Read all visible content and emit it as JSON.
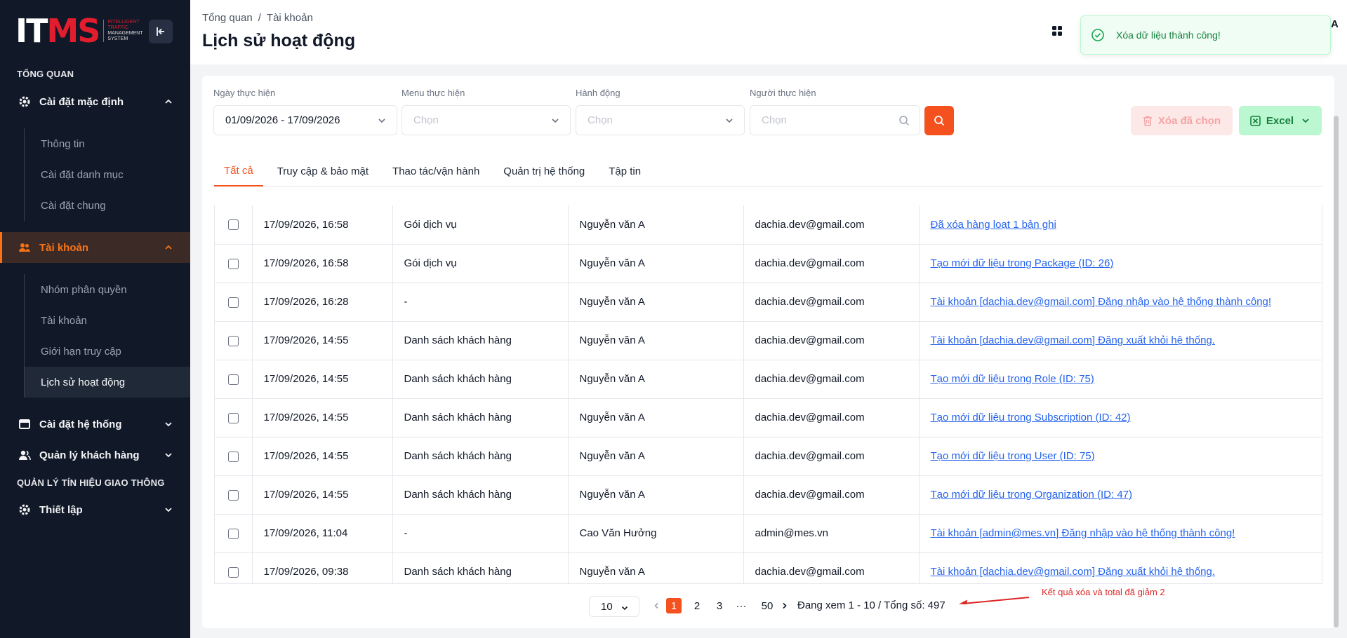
{
  "sidebar": {
    "logo": {
      "main_left": "IT",
      "main_right": "MS",
      "sub1": "INTELLIGENT",
      "sub2": "TRAFFIC",
      "sub3": "MANAGEMENT",
      "sub4": "SYSTEM"
    },
    "section_overview": "TỔNG QUAN",
    "default_settings": {
      "label": "Cài đặt mặc định",
      "items": [
        "Thông tin",
        "Cài đặt danh mục",
        "Cài đặt chung"
      ]
    },
    "accounts": {
      "label": "Tài khoản",
      "items": [
        "Nhóm phân quyền",
        "Tài khoản",
        "Giới hạn truy cập",
        "Lịch sử hoạt động"
      ]
    },
    "system_settings": "Cài đặt hệ thống",
    "customers": "Quản lý khách hàng",
    "section_traffic": "QUẢN LÝ TÍN HIỆU GIAO THÔNG",
    "setup": "Thiết lập"
  },
  "header": {
    "breadcrumb": [
      "Tổng quan",
      "Tài khoản"
    ],
    "breadcrumb_sep": "/",
    "title": "Lịch sử hoạt động",
    "corner_letter": "A"
  },
  "toast": {
    "message": "Xóa dữ liệu thành công!"
  },
  "filters": {
    "date_label": "Ngày thực hiện",
    "date_value": "01/09/2026 - 17/09/2026",
    "menu_label": "Menu thực hiện",
    "menu_placeholder": "Chọn",
    "action_label": "Hành động",
    "action_placeholder": "Chọn",
    "user_label": "Người thực hiện",
    "user_placeholder": "Chọn"
  },
  "actions": {
    "delete_selected": "Xóa đã chọn",
    "excel": "Excel"
  },
  "tabs": [
    "Tất cả",
    "Truy cập & bảo mật",
    "Thao tác/vận hành",
    "Quản trị hệ thống",
    "Tập tin"
  ],
  "rows": [
    {
      "time": "17/09/2026, 16:58",
      "menu": "Gói dịch vụ",
      "user": "Nguyễn văn A",
      "email": "dachia.dev@gmail.com",
      "desc": "Đã xóa hàng loạt 1 bản ghi"
    },
    {
      "time": "17/09/2026, 16:58",
      "menu": "Gói dịch vụ",
      "user": "Nguyễn văn A",
      "email": "dachia.dev@gmail.com",
      "desc": "Tạo mới dữ liệu trong Package (ID: 26)"
    },
    {
      "time": "17/09/2026, 16:28",
      "menu": "-",
      "user": "Nguyễn văn A",
      "email": "dachia.dev@gmail.com",
      "desc": "Tài khoản [dachia.dev@gmail.com] Đăng nhập vào hệ thống thành công!"
    },
    {
      "time": "17/09/2026, 14:55",
      "menu": "Danh sách khách hàng",
      "user": "Nguyễn văn A",
      "email": "dachia.dev@gmail.com",
      "desc": "Tài khoản [dachia.dev@gmail.com] Đăng xuất khỏi hệ thống."
    },
    {
      "time": "17/09/2026, 14:55",
      "menu": "Danh sách khách hàng",
      "user": "Nguyễn văn A",
      "email": "dachia.dev@gmail.com",
      "desc": "Tạo mới dữ liệu trong Role (ID: 75)"
    },
    {
      "time": "17/09/2026, 14:55",
      "menu": "Danh sách khách hàng",
      "user": "Nguyễn văn A",
      "email": "dachia.dev@gmail.com",
      "desc": "Tạo mới dữ liệu trong Subscription (ID: 42)"
    },
    {
      "time": "17/09/2026, 14:55",
      "menu": "Danh sách khách hàng",
      "user": "Nguyễn văn A",
      "email": "dachia.dev@gmail.com",
      "desc": "Tạo mới dữ liệu trong User (ID: 75)"
    },
    {
      "time": "17/09/2026, 14:55",
      "menu": "Danh sách khách hàng",
      "user": "Nguyễn văn A",
      "email": "dachia.dev@gmail.com",
      "desc": "Tạo mới dữ liệu trong Organization (ID: 47)"
    },
    {
      "time": "17/09/2026, 11:04",
      "menu": "-",
      "user": "Cao Văn Hưởng",
      "email": "admin@mes.vn",
      "desc": "Tài khoản [admin@mes.vn] Đăng nhập vào hệ thống thành công!"
    },
    {
      "time": "17/09/2026, 09:38",
      "menu": "Danh sách khách hàng",
      "user": "Nguyễn văn A",
      "email": "dachia.dev@gmail.com",
      "desc": "Tài khoản [dachia.dev@gmail.com] Đăng xuất khỏi hệ thống."
    }
  ],
  "pagination": {
    "page_size": "10",
    "pages": [
      "1",
      "2",
      "3",
      "···",
      "50"
    ],
    "current_page": "1",
    "info": "Đang xem 1 - 10 / Tổng số: 497"
  },
  "annotation": "Kết quả xóa và total đã giảm 2",
  "colors": {
    "accent": "#f4511e",
    "sidebar_bg": "#111827",
    "link": "#2563eb",
    "success": "#15803d"
  }
}
